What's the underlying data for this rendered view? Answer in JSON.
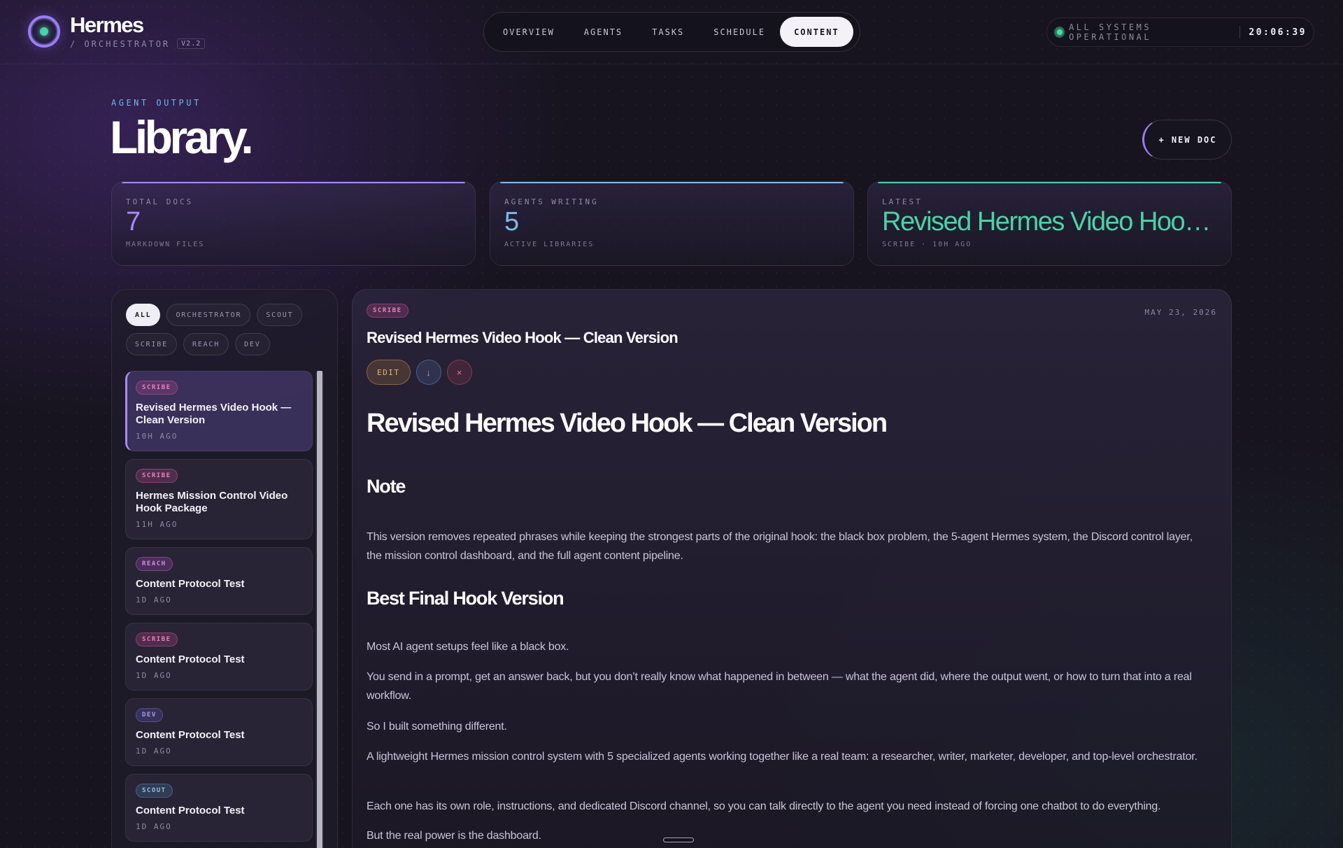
{
  "header": {
    "brand": "Hermes",
    "subtitle": "/ ORCHESTRATOR",
    "version": "V2.2",
    "nav": [
      {
        "label": "OVERVIEW"
      },
      {
        "label": "AGENTS"
      },
      {
        "label": "TASKS"
      },
      {
        "label": "SCHEDULE"
      },
      {
        "label": "CONTENT",
        "active": true
      }
    ],
    "status_text": "ALL SYSTEMS OPERATIONAL",
    "clock": "20:06:39"
  },
  "page": {
    "eyebrow": "AGENT OUTPUT",
    "title": "Library.",
    "new_doc_label": "+ NEW DOC"
  },
  "stats": [
    {
      "label": "TOTAL DOCS",
      "value": "7",
      "sub": "MARKDOWN FILES"
    },
    {
      "label": "AGENTS WRITING",
      "value": "5",
      "sub": "ACTIVE LIBRARIES"
    },
    {
      "label": "LATEST",
      "value": "Revised Hermes Video Hook — Clean Version",
      "sub": "SCRIBE · 10H AGO"
    }
  ],
  "filters": [
    "ALL",
    "ORCHESTRATOR",
    "SCOUT",
    "SCRIBE",
    "REACH",
    "DEV"
  ],
  "documents": [
    {
      "tag": "SCRIBE",
      "title": "Revised Hermes Video Hook — Clean Version",
      "time": "10H AGO"
    },
    {
      "tag": "SCRIBE",
      "title": "Hermes Mission Control Video Hook Package",
      "time": "11H AGO"
    },
    {
      "tag": "REACH",
      "title": "Content Protocol Test",
      "time": "1D AGO"
    },
    {
      "tag": "SCRIBE",
      "title": "Content Protocol Test",
      "time": "1D AGO"
    },
    {
      "tag": "DEV",
      "title": "Content Protocol Test",
      "time": "1D AGO"
    },
    {
      "tag": "SCOUT",
      "title": "Content Protocol Test",
      "time": "1D AGO"
    }
  ],
  "viewer": {
    "tag": "SCRIBE",
    "date": "MAY 23, 2026",
    "title": "Revised Hermes Video Hook — Clean Version",
    "edit_label": "EDIT",
    "download_icon": "↓",
    "delete_icon": "×",
    "h1": "Revised Hermes Video Hook — Clean Version",
    "note_heading": "Note",
    "note_text": "This version removes repeated phrases while keeping the strongest parts of the original hook: the black box problem, the 5-agent Hermes system, the Discord control layer, the mission control dashboard, and the full agent content pipeline.",
    "best_heading": "Best Final Hook Version",
    "paragraphs": [
      "Most AI agent setups feel like a black box.",
      "You send in a prompt, get an answer back, but you don’t really know what happened in between — what the agent did, where the output went, or how to turn that into a real workflow.",
      "So I built something different.",
      "A lightweight Hermes mission control system with 5 specialized agents working together like a real team: a researcher, writer, marketer, developer, and top-level orchestrator.",
      "Each one has its own role, instructions, and dedicated Discord channel, so you can talk directly to the agent you need instead of forcing one chatbot to do everything.",
      "But the real power is the dashboard."
    ]
  },
  "colors": {
    "accent": "#a88bf7",
    "blue": "#7fb8e8",
    "green": "#4ad3a6"
  }
}
